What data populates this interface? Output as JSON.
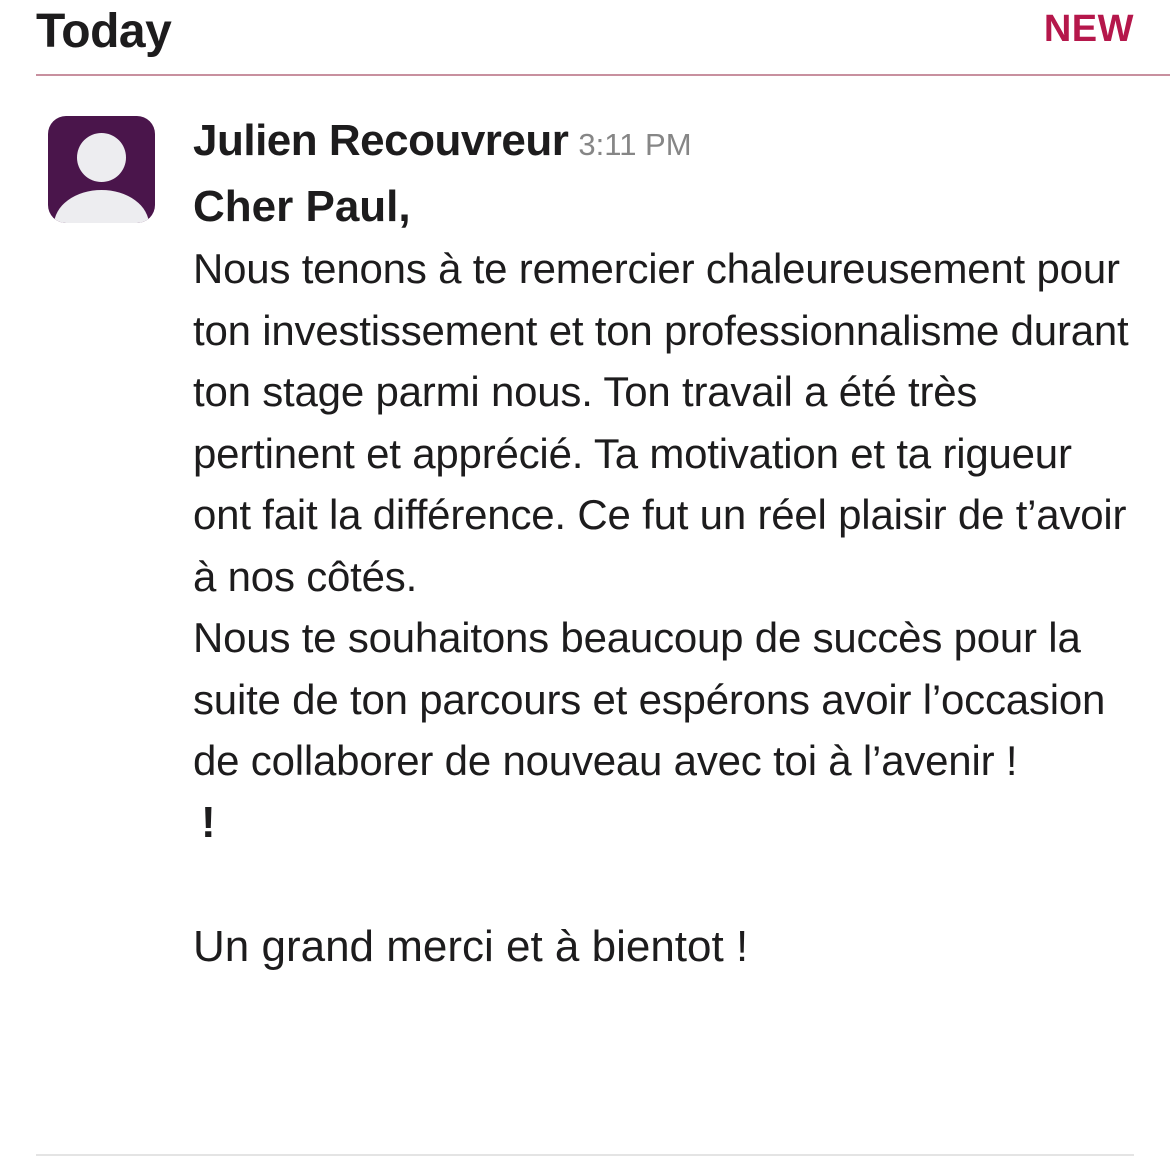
{
  "header": {
    "day_label": "Today",
    "new_badge": "NEW"
  },
  "message": {
    "sender": "Julien Recouvreur",
    "time": "3:11 PM",
    "greeting": "Cher Paul,",
    "paragraph1": "Nous tenons à te remercier chaleureusement pour ton investissement et ton professionnalisme durant ton stage parmi nous. Ton travail a été très pertinent et apprécié. Ta motivation et ta rigueur ont fait la différence. Ce fut un réel plaisir de t’avoir à nos côtés.",
    "paragraph2": "Nous te souhaitons beaucoup de succès pour la suite de ton parcours et espérons avoir l’occasion de collaborer de nouveau avec toi à l’avenir !",
    "exclamation": "!",
    "closing": "Un grand merci et à bientot !"
  },
  "colors": {
    "avatar_bg": "#4a154b",
    "new_badge": "#b5174b",
    "timestamp": "#868686",
    "text": "#1d1c1d"
  },
  "icons": {
    "avatar": "default-user-avatar-icon"
  }
}
